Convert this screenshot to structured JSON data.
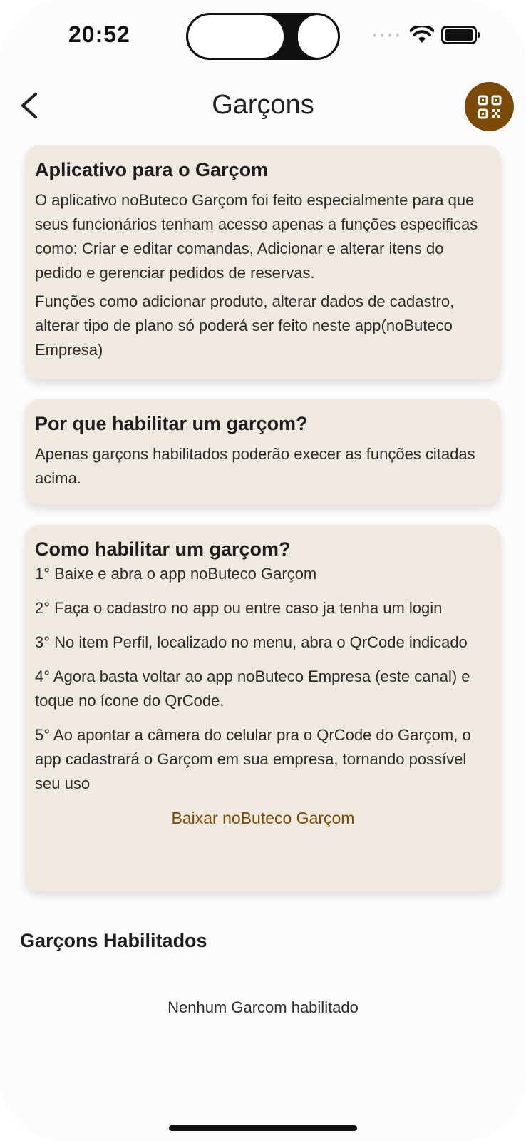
{
  "status": {
    "time": "20:52",
    "signal_icon": "signal-dots-icon",
    "wifi_icon": "wifi-icon",
    "battery_icon": "battery-icon"
  },
  "header": {
    "title": "Garçons",
    "back_icon": "chevron-left-icon",
    "qr_icon": "qrcode-icon"
  },
  "card1": {
    "title": "Aplicativo para o Garçom",
    "paragraphs": [
      "O aplicativo noButeco Garçom foi feito especialmente para que seus funcionários tenham acesso apenas a funções especificas como: Criar e editar comandas, Adicionar e alterar itens do pedido e gerenciar pedidos de reservas.",
      "Funções como adicionar produto, alterar dados de cadastro, alterar tipo de plano só poderá ser feito neste app(noButeco Empresa)"
    ]
  },
  "card2": {
    "title": "Por que habilitar um garçom?",
    "text": "Apenas garçons habilitados poderão execer as funções citadas acima."
  },
  "card3": {
    "title": "Como habilitar um garçom?",
    "steps": [
      "1° Baixe e abra o app noButeco Garçom",
      "2° Faça o cadastro no app ou entre caso ja tenha um login",
      "3° No item Perfil, localizado no menu, abra o QrCode indicado",
      "4° Agora basta voltar ao app noButeco Empresa (este canal) e toque no ícone do QrCode.",
      "5° Ao apontar a câmera do celular pra o QrCode do Garçom, o app cadastrará o Garçom em sua empresa, tornando possível seu uso"
    ],
    "link": "Baixar noButeco Garçom"
  },
  "enabled": {
    "title": "Garçons Habilitados",
    "empty": "Nenhum Garcom habilitado"
  },
  "colors": {
    "accent": "#7a4a06",
    "card_bg": "#efe9df",
    "page_bg": "#fdfbfd"
  }
}
